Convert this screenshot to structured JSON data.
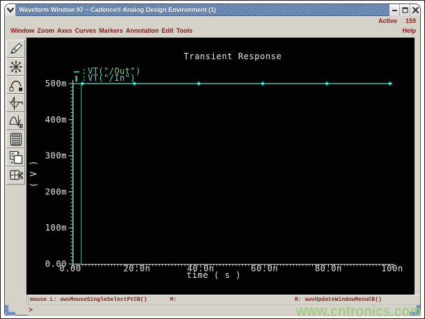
{
  "window": {
    "title": "Waveform Window 97 ~ Cadence® Analog Design Environment (1)",
    "controls": [
      "minimize",
      "maximize",
      "close"
    ]
  },
  "header": {
    "active_label": "Active",
    "active_value": "159"
  },
  "menubar": {
    "items": [
      "Window",
      "Zoom",
      "Axes",
      "Curves",
      "Markers",
      "Annotation",
      "Edit",
      "Tools"
    ],
    "help_label": "Help"
  },
  "toolbar": {
    "buttons": [
      "pen-icon",
      "starburst-icon",
      "trace-hop-icon",
      "axis-waveform-icon",
      "waveform-b-icon",
      "calculator-icon",
      "copy-window-icon",
      "cut-window-icon"
    ]
  },
  "statusbar": {
    "mouse_left": "mouse L: awvMouseSingleSelectPtCB()",
    "mouse_middle": "M:",
    "mouse_right": "R: awvUpdateWindowMenuCB()"
  },
  "prompt": {
    "symbol": ">"
  },
  "watermark": {
    "text": "www.cntronics.com"
  },
  "colors": {
    "out_trace": "#3f9e5e",
    "in_trace": "#56c8c0",
    "marker": "#38e2d2",
    "axis": "#c9c9c9",
    "plot_text": "#e6e6e6",
    "menu_text": "#7f1f1f",
    "titlebar_blue": "#54749f"
  },
  "chart_data": {
    "type": "line",
    "title": "Transient Response",
    "xlabel": "time ( s )",
    "ylabel": "(V)",
    "xlim_ns": [
      0,
      100
    ],
    "ylim_v": [
      0,
      0.5
    ],
    "x_ticks": [
      {
        "t_ns": 0,
        "label": "0.00"
      },
      {
        "t_ns": 20,
        "label": "20.0n"
      },
      {
        "t_ns": 40,
        "label": "40.0n"
      },
      {
        "t_ns": 60,
        "label": "60.0n"
      },
      {
        "t_ns": 80,
        "label": "80.0n"
      },
      {
        "t_ns": 100,
        "label": "100n"
      }
    ],
    "y_ticks": [
      {
        "v": 0.0,
        "label": "0.00"
      },
      {
        "v": 0.1,
        "label": "100m"
      },
      {
        "v": 0.2,
        "label": "200m"
      },
      {
        "v": 0.3,
        "label": "300m"
      },
      {
        "v": 0.4,
        "label": "400m"
      },
      {
        "v": 0.5,
        "label": "500m"
      }
    ],
    "minor_tick_step_x_ns": 1,
    "minor_tick_step_y_v": 0.01,
    "legend_position": "top-left",
    "grid": false,
    "series": [
      {
        "name": "VT(\"/Out\")",
        "color": "#3f9e5e",
        "legend_glyph": "horizontal-dash",
        "legend_text_color": "#79c9a0",
        "points": [
          [
            0,
            0
          ],
          [
            2.5,
            0
          ],
          [
            2.5,
            0.5
          ],
          [
            100,
            0.5
          ]
        ]
      },
      {
        "name": "VT(\"/In\")",
        "color": "#56c8c0",
        "legend_glyph": "vertical-dash",
        "legend_text_color": "#67d2c9",
        "marker": "diamond",
        "marker_color": "#38e2d2",
        "marker_times_ns": [
          2.9,
          19.2,
          39.4,
          59.4,
          79.5,
          99.3
        ],
        "points": [
          [
            0,
            0
          ],
          [
            0,
            0.5
          ],
          [
            100,
            0.5
          ]
        ]
      }
    ]
  }
}
